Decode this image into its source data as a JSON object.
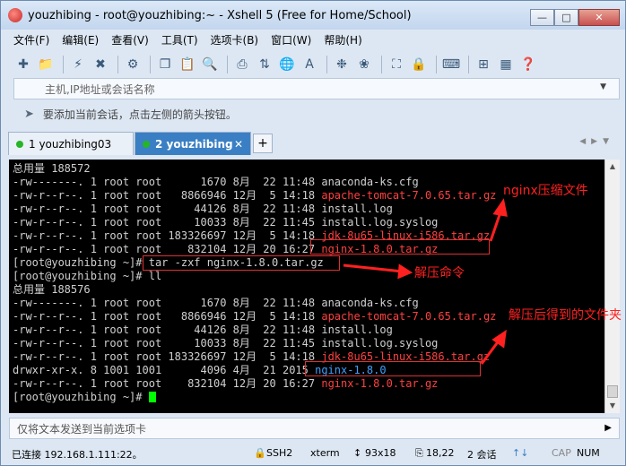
{
  "window": {
    "title": "youzhibing - root@youzhibing:~ - Xshell 5 (Free for Home/School)"
  },
  "menu": [
    "文件(F)",
    "编辑(E)",
    "查看(V)",
    "工具(T)",
    "选项卡(B)",
    "窗口(W)",
    "帮助(H)"
  ],
  "address_bar": {
    "placeholder": "主机,IP地址或会话名称"
  },
  "hint": "要添加当前会话，点击左侧的箭头按钮。",
  "tabs": [
    {
      "label": "1 youzhibing03",
      "active": false
    },
    {
      "label": "2 youzhibing",
      "active": true
    }
  ],
  "terminal": {
    "lines": [
      {
        "a": "总用量 188572",
        "f": ""
      },
      {
        "a": "-rw-------. 1 root root      1670 8月  22 11:48 ",
        "f": "anaconda-ks.cfg",
        "c": ""
      },
      {
        "a": "-rw-r--r--. 1 root root   8866946 12月  5 14:18 ",
        "f": "apache-tomcat-7.0.65.tar.gz",
        "c": "red"
      },
      {
        "a": "-rw-r--r--. 1 root root     44126 8月  22 11:48 ",
        "f": "install.log",
        "c": ""
      },
      {
        "a": "-rw-r--r--. 1 root root     10033 8月  22 11:45 ",
        "f": "install.log.syslog",
        "c": ""
      },
      {
        "a": "-rw-r--r--. 1 root root 183326697 12月  5 14:18 ",
        "f": "jdk-8u65-linux-i586.tar.gz",
        "c": "red"
      },
      {
        "a": "-rw-r--r--. 1 root root    832104 12月 20 16:27 ",
        "f": "nginx-1.8.0.tar.gz",
        "c": "red"
      },
      {
        "a": "[root@youzhibing ~]# ",
        "f": "tar -zxf nginx-1.8.0.tar.gz",
        "c": ""
      },
      {
        "a": "[root@youzhibing ~]# ",
        "f": "ll",
        "c": ""
      },
      {
        "a": "总用量 188576",
        "f": ""
      },
      {
        "a": "-rw-------. 1 root root      1670 8月  22 11:48 ",
        "f": "anaconda-ks.cfg",
        "c": ""
      },
      {
        "a": "-rw-r--r--. 1 root root   8866946 12月  5 14:18 ",
        "f": "apache-tomcat-7.0.65.tar.gz",
        "c": "red"
      },
      {
        "a": "-rw-r--r--. 1 root root     44126 8月  22 11:48 ",
        "f": "install.log",
        "c": ""
      },
      {
        "a": "-rw-r--r--. 1 root root     10033 8月  22 11:45 ",
        "f": "install.log.syslog",
        "c": ""
      },
      {
        "a": "-rw-r--r--. 1 root root 183326697 12月  5 14:18 ",
        "f": "jdk-8u65-linux-i586.tar.gz",
        "c": "red"
      },
      {
        "a": "drwxr-xr-x. 8 1001 1001      4096 4月  21 2015 ",
        "f": "nginx-1.8.0",
        "c": "blue"
      },
      {
        "a": "-rw-r--r--. 1 root root    832104 12月 20 16:27 ",
        "f": "nginx-1.8.0.tar.gz",
        "c": "red"
      },
      {
        "a": "[root@youzhibing ~]# ",
        "f": "",
        "c": "",
        "cursor": true
      }
    ]
  },
  "annotations": {
    "compressed_file": "nginx压缩文件",
    "extract_command": "解压命令",
    "extracted_folder": "解压后得到的文件夹"
  },
  "input_bar": {
    "placeholder": "仅将文本发送到当前选项卡"
  },
  "status": {
    "connected": "已连接 192.168.1.111:22。",
    "protocol": "SSH2",
    "term": "xterm",
    "size": "93x18",
    "cursor_pos": "18,22",
    "sessions": "2 会话",
    "caps": "CAP",
    "num": "NUM"
  },
  "colors": {
    "file_red": "#ff4040",
    "dir_blue": "#3fa0ff",
    "annotation": "#ff2020",
    "active_tab": "#3a7fc4"
  }
}
